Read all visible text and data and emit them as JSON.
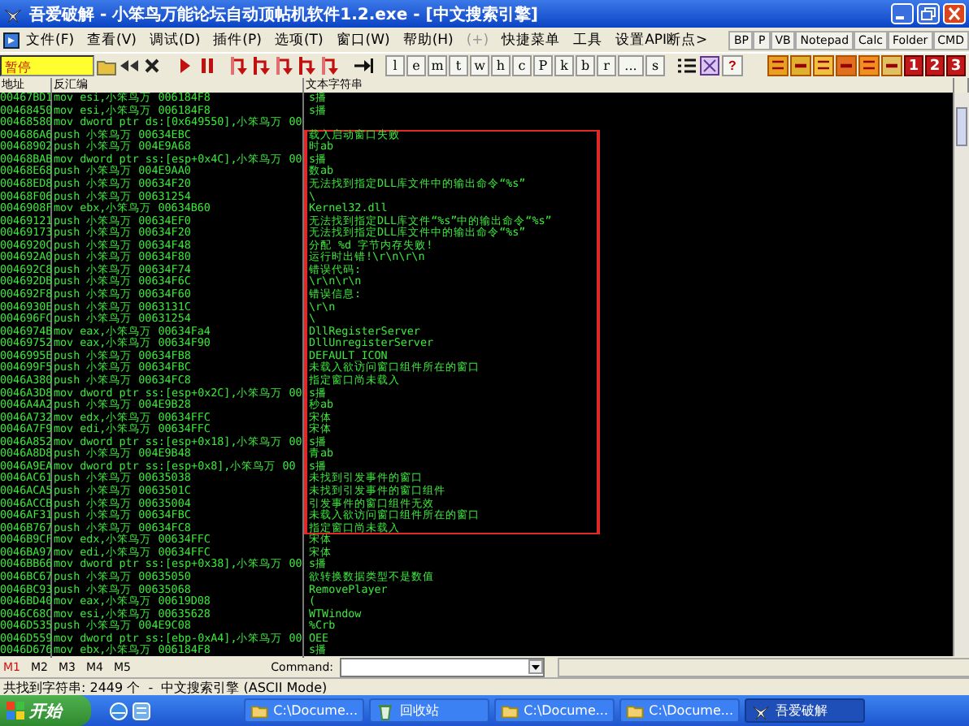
{
  "window": {
    "title": "吾爱破解 - 小笨鸟万能论坛自动顶帖机软件1.2.exe - [中文搜索引擎]"
  },
  "menu": [
    {
      "label": "文件(F)",
      "disabled": false
    },
    {
      "label": "查看(V)",
      "disabled": false
    },
    {
      "label": "调试(D)",
      "disabled": false
    },
    {
      "label": "插件(P)",
      "disabled": false
    },
    {
      "label": "选项(T)",
      "disabled": false
    },
    {
      "label": "窗口(W)",
      "disabled": false
    },
    {
      "label": "帮助(H)",
      "disabled": false
    },
    {
      "label": "(+)",
      "disabled": true
    },
    {
      "label": "快捷菜单",
      "disabled": false
    },
    {
      "label": "工具",
      "disabled": false
    },
    {
      "label": "设置API断点>",
      "disabled": false
    }
  ],
  "quick_buttons": [
    "BP",
    "P",
    "VB",
    "Notepad",
    "Calc",
    "Folder",
    "CMD"
  ],
  "toolbar": {
    "status": "暂停",
    "letter_buttons": [
      "l",
      "e",
      "m",
      "t",
      "w",
      "h",
      "c",
      "P",
      "k",
      "b",
      "r",
      "...",
      "s"
    ],
    "help_button": "?",
    "window_buttons": [
      "1",
      "2",
      "3"
    ]
  },
  "columns": [
    "地址",
    "反汇编",
    "文本字符串"
  ],
  "rows": [
    {
      "address": "00467BD1",
      "disassembly": "mov esi,小笨鸟万 006184F8",
      "text": "s播",
      "boxed": false
    },
    {
      "address": "00468450",
      "disassembly": "mov esi,小笨鸟万 006184F8",
      "text": "s播",
      "boxed": false
    },
    {
      "address": "00468580",
      "disassembly": "mov dword ptr ds:[0x649550],小笨鸟万 00",
      "boxed": false
    },
    {
      "address": "004686A6",
      "disassembly": "push 小笨鸟万 00634EBC",
      "text": "载入启动窗口失败",
      "boxed": true
    },
    {
      "address": "00468902",
      "disassembly": "push 小笨鸟万 004E9A68",
      "text": "时ab",
      "boxed": true
    },
    {
      "address": "00468BAB",
      "disassembly": "mov dword ptr ss:[esp+0x4C],小笨鸟万 00",
      "text": "s播",
      "boxed": true
    },
    {
      "address": "00468E68",
      "disassembly": "push 小笨鸟万 004E9AA0",
      "text": "数ab",
      "boxed": true
    },
    {
      "address": "00468ED8",
      "disassembly": "push 小笨鸟万 00634F20",
      "text": "无法找到指定DLL库文件中的输出命令“%s”",
      "boxed": true
    },
    {
      "address": "00468F06",
      "disassembly": "push 小笨鸟万 00631254",
      "text": "\\",
      "boxed": true
    },
    {
      "address": "0046908F",
      "disassembly": "mov ebx,小笨鸟万 00634B60",
      "text": "Kernel32.dll",
      "boxed": true
    },
    {
      "address": "00469121",
      "disassembly": "push 小笨鸟万 00634EF0",
      "text": "无法找到指定DLL库文件“%s”中的输出命令“%s”",
      "boxed": true
    },
    {
      "address": "00469173",
      "disassembly": "push 小笨鸟万 00634F20",
      "text": "无法找到指定DLL库文件中的输出命令“%s”",
      "boxed": true
    },
    {
      "address": "0046920C",
      "disassembly": "push 小笨鸟万 00634F48",
      "text": "分配 %d 字节内存失败!",
      "boxed": true
    },
    {
      "address": "004692A0",
      "disassembly": "push 小笨鸟万 00634F80",
      "text": "运行时出错!\\r\\n\\r\\n",
      "boxed": true
    },
    {
      "address": "004692C8",
      "disassembly": "push 小笨鸟万 00634F74",
      "text": "错误代码:",
      "boxed": true
    },
    {
      "address": "004692DB",
      "disassembly": "push 小笨鸟万 00634F6C",
      "text": "\\r\\n\\r\\n",
      "boxed": true
    },
    {
      "address": "004692F8",
      "disassembly": "push 小笨鸟万 00634F60",
      "text": "错误信息:",
      "boxed": true
    },
    {
      "address": "0046930E",
      "disassembly": "push 小笨鸟万 0063131C",
      "text": "\\r\\n",
      "boxed": true
    },
    {
      "address": "004696FC",
      "disassembly": "push 小笨鸟万 00631254",
      "text": "\\",
      "boxed": true
    },
    {
      "address": "0046974B",
      "disassembly": "mov eax,小笨鸟万 00634Fa4",
      "text": "DllRegisterServer",
      "boxed": true
    },
    {
      "address": "00469752",
      "disassembly": "mov eax,小笨鸟万 00634F90",
      "text": "DllUnregisterServer",
      "boxed": true
    },
    {
      "address": "0046995E",
      "disassembly": "push 小笨鸟万 00634FB8",
      "text": "DEFAULT_ICON",
      "boxed": true
    },
    {
      "address": "004699F5",
      "disassembly": "push 小笨鸟万 00634FBC",
      "text": "未载入欲访问窗口组件所在的窗口",
      "boxed": true
    },
    {
      "address": "0046A380",
      "disassembly": "push 小笨鸟万 00634FC8",
      "text": "指定窗口尚未载入",
      "boxed": true
    },
    {
      "address": "0046A3D8",
      "disassembly": "mov dword ptr ss:[esp+0x2C],小笨鸟万 00",
      "text": "s播",
      "boxed": true
    },
    {
      "address": "0046A4A2",
      "disassembly": "push 小笨鸟万 004E9B28",
      "text": "秒ab",
      "boxed": true
    },
    {
      "address": "0046A732",
      "disassembly": "mov edx,小笨鸟万 00634FFC",
      "text": "宋体",
      "boxed": true
    },
    {
      "address": "0046A7F9",
      "disassembly": "mov edi,小笨鸟万 00634FFC",
      "text": "宋体",
      "boxed": true
    },
    {
      "address": "0046A852",
      "disassembly": "mov dword ptr ss:[esp+0x18],小笨鸟万 00",
      "text": "s播",
      "boxed": true
    },
    {
      "address": "0046A8D8",
      "disassembly": "push 小笨鸟万 004E9B48",
      "text": "青ab",
      "boxed": true
    },
    {
      "address": "0046A9EA",
      "disassembly": "mov dword ptr ss:[esp+0x8],小笨鸟万 00",
      "text": "s播",
      "boxed": true
    },
    {
      "address": "0046AC61",
      "disassembly": "push 小笨鸟万 00635038",
      "text": "未找到引发事件的窗口",
      "boxed": true
    },
    {
      "address": "0046ACA5",
      "disassembly": "push 小笨鸟万 0063501C",
      "text": "未找到引发事件的窗口组件",
      "boxed": true
    },
    {
      "address": "0046ACCB",
      "disassembly": "push 小笨鸟万 00635004",
      "text": "引发事件的窗口组件无效",
      "boxed": true
    },
    {
      "address": "0046AF31",
      "disassembly": "push 小笨鸟万 00634FBC",
      "text": "未载入欲访问窗口组件所在的窗口",
      "boxed": true
    },
    {
      "address": "0046B767",
      "disassembly": "push 小笨鸟万 00634FC8",
      "text": "指定窗口尚未载入",
      "boxed": true
    },
    {
      "address": "0046B9CF",
      "disassembly": "mov edx,小笨鸟万 00634FFC",
      "text": "宋体",
      "boxed": false
    },
    {
      "address": "0046BA97",
      "disassembly": "mov edi,小笨鸟万 00634FFC",
      "text": "宋体",
      "boxed": false
    },
    {
      "address": "0046BB66",
      "disassembly": "mov dword ptr ss:[esp+0x38],小笨鸟万 00",
      "text": "s播",
      "boxed": false
    },
    {
      "address": "0046BC67",
      "disassembly": "push 小笨鸟万 00635050",
      "text": "欲转换数据类型不是数值",
      "boxed": false
    },
    {
      "address": "0046BC93",
      "disassembly": "push 小笨鸟万 00635068",
      "text": "RemovePlayer",
      "boxed": false
    },
    {
      "address": "0046BD40",
      "disassembly": "mov eax,小笨鸟万 00619D08",
      "text": "(",
      "boxed": false
    },
    {
      "address": "0046C68C",
      "disassembly": "mov esi,小笨鸟万 00635628",
      "text": "WTWindow",
      "boxed": false
    },
    {
      "address": "0046D535",
      "disassembly": "push 小笨鸟万 004E9C08",
      "text": "%Crb",
      "boxed": false
    },
    {
      "address": "0046D559",
      "disassembly": "mov dword ptr ss:[ebp-0xA4],小笨鸟万 00",
      "text": "OEE",
      "boxed": false
    },
    {
      "address": "0046D676",
      "disassembly": "mov ebx,小笨鸟万 006184F8",
      "text": "s播",
      "boxed": false
    }
  ],
  "bottom": {
    "tabs": [
      {
        "label": "M1",
        "selected": true
      },
      {
        "label": "M2",
        "selected": false
      },
      {
        "label": "M3",
        "selected": false
      },
      {
        "label": "M4",
        "selected": false
      },
      {
        "label": "M5",
        "selected": false
      }
    ],
    "command_label": "Command:"
  },
  "status_bar": "共找到字符串: 2449 个  -  中文搜索引擎 (ASCII Mode)",
  "taskbar": {
    "start": "开始",
    "items": [
      {
        "kind": "folder",
        "label": "C:\\Docume...",
        "selected": false
      },
      {
        "kind": "recycle",
        "label": "回收站",
        "selected": false
      },
      {
        "kind": "folder",
        "label": "C:\\Docume...",
        "selected": false
      },
      {
        "kind": "folder",
        "label": "C:\\Docume...",
        "selected": false
      },
      {
        "kind": "app",
        "label": "吾爱破解",
        "selected": true
      }
    ]
  }
}
